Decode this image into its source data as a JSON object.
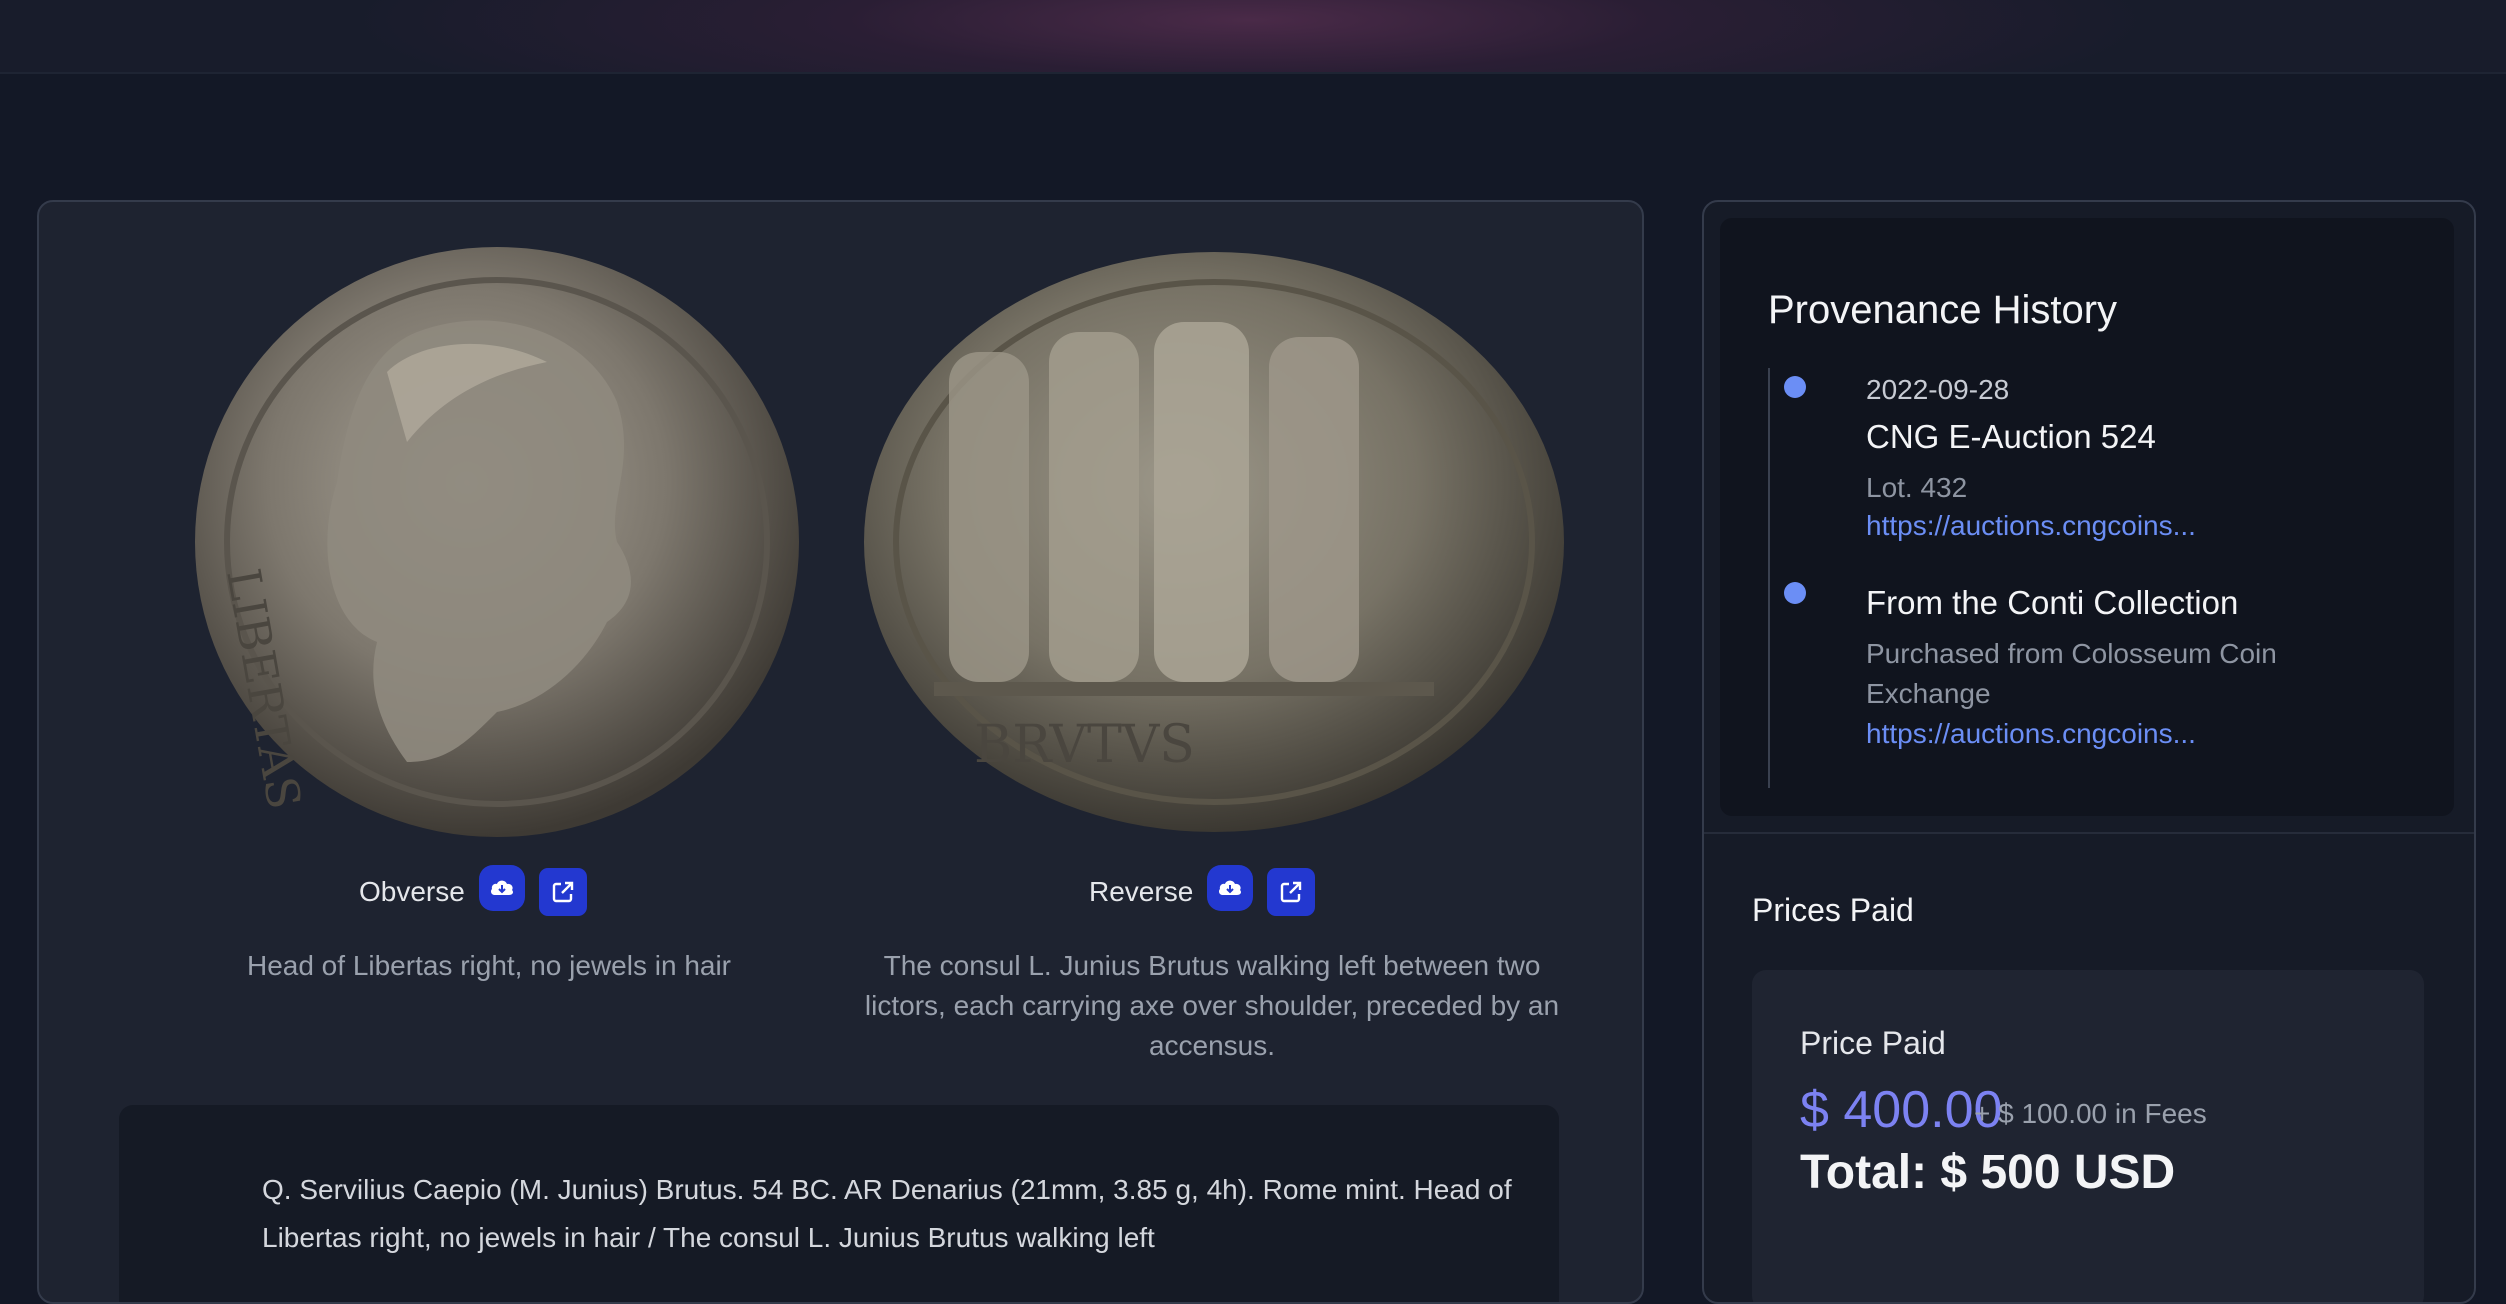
{
  "coin": {
    "obverse": {
      "label": "Obverse",
      "description": "Head of Libertas right, no jewels in hair",
      "legend": "LIBERTAS"
    },
    "reverse": {
      "label": "Reverse",
      "description": "The consul L. Junius Brutus walking left between two lictors, each carrying axe over shoulder, preceded by an accensus.",
      "legend": "BRVTVS"
    },
    "full_description": "Q. Servilius Caepio (M. Junius) Brutus. 54 BC. AR Denarius (21mm, 3.85 g, 4h). Rome mint. Head of Libertas right, no jewels in hair / The consul L. Junius Brutus walking left"
  },
  "icons": {
    "download": "cloud-download-icon",
    "external": "external-link-icon"
  },
  "provenance": {
    "title": "Provenance History",
    "entries": [
      {
        "date": "2022-09-28",
        "name": "CNG E-Auction 524",
        "detail": "Lot. 432",
        "link": "https://auctions.cngcoins..."
      },
      {
        "name": "From the Conti Collection",
        "detail": "Purchased from Colosseum Coin Exchange",
        "link": "https://auctions.cngcoins..."
      }
    ]
  },
  "prices": {
    "title": "Prices Paid",
    "label": "Price Paid",
    "amount": "$ 400.00",
    "fees": "+ $ 100.00 in Fees",
    "total": "Total: $ 500 USD"
  },
  "colors": {
    "accent_button": "#2338d0",
    "link": "#6b8ef5",
    "price": "#7c82f2",
    "background": "#131826"
  }
}
